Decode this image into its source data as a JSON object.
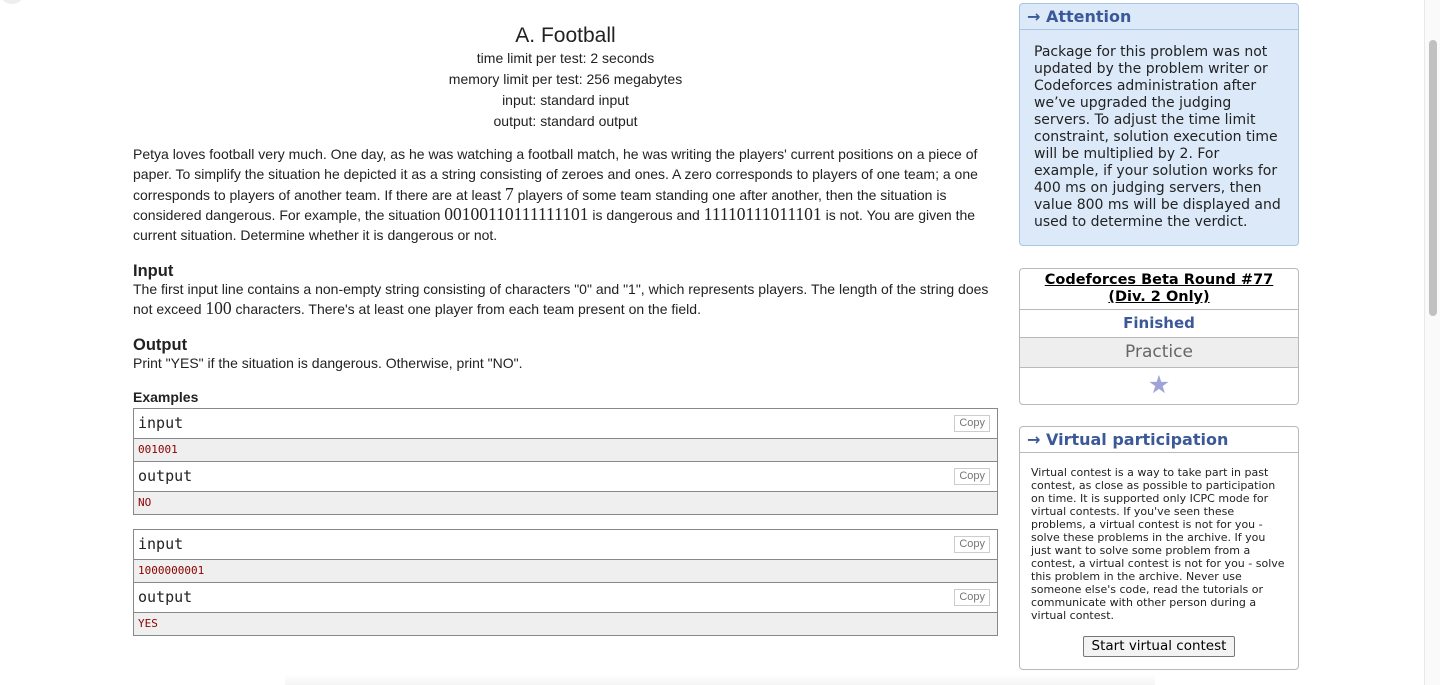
{
  "problem": {
    "title": "A. Football",
    "time_limit": "time limit per test: 2 seconds",
    "memory_limit": "memory limit per test: 256 megabytes",
    "input_file": "input: standard input",
    "output_file": "output: standard output",
    "legend": {
      "p1": "Petya loves football very much. One day, as he was watching a football match, he was writing the players' current positions on a piece of paper. To simplify the situation he depicted it as a string consisting of zeroes and ones. A zero corresponds to players of one team; a one corresponds to players of another team. If there are at least ",
      "n7": "7",
      "p2": " players of some team standing one after another, then the situation is considered dangerous. For example, the situation ",
      "ex1": "00100110111111101",
      "p3": " is dangerous and ",
      "ex2": "11110111011101",
      "p4": " is not. You are given the current situation. Determine whether it is dangerous or not."
    },
    "input_section": {
      "title": "Input",
      "p1": "The first input line contains a non-empty string consisting of characters \"0\" and \"1\", which represents players. The length of the string does not exceed ",
      "n100": "100",
      "p2": " characters. There's at least one player from each team present on the field."
    },
    "output_section": {
      "title": "Output",
      "text": "Print \"YES\" if the situation is dangerous. Otherwise, print \"NO\"."
    },
    "examples_title": "Examples",
    "copy_label": "Copy",
    "samples": [
      {
        "input_label": "input",
        "input": "001001",
        "output_label": "output",
        "output": "NO"
      },
      {
        "input_label": "input",
        "input": "1000000001",
        "output_label": "output",
        "output": "YES"
      }
    ]
  },
  "sidebar": {
    "attention": {
      "caption": "→ Attention",
      "text": "Package for this problem was not updated by the problem writer or Codeforces administration after we’ve upgraded the judging servers. To adjust the time limit constraint, solution execution time will be multiplied by 2. For example, if your solution works for 400 ms on judging servers, then value 800 ms will be displayed and used to determine the verdict."
    },
    "contest": {
      "name": "Codeforces Beta Round #77 (Div. 2 Only)",
      "status": "Finished",
      "practice": "Practice",
      "star_icon": "star-icon"
    },
    "virtual": {
      "caption": "→ Virtual participation",
      "text": "Virtual contest is a way to take part in past contest, as close as possible to participation on time. It is supported only ICPC mode for virtual contests. If you've seen these problems, a virtual contest is not for you - solve these problems in the archive. If you just want to solve some problem from a contest, a virtual contest is not for you - solve this problem in the archive. Never use someone else's code, read the tutorials or communicate with other person during a virtual contest.",
      "button": "Start virtual contest"
    }
  }
}
